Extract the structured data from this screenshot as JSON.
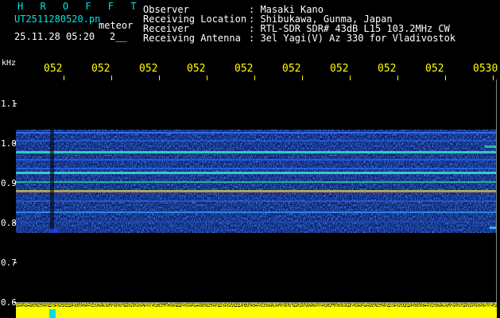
{
  "header": {
    "station": "H R O F F T",
    "filename": "UT2511280520.pn",
    "mode": "meteor",
    "datetime": "25.11.28 05:20",
    "code": "2__",
    "info": [
      {
        "label": "Observer",
        "value": ": Masaki Kano"
      },
      {
        "label": "Receiving Location",
        "value": ": Shibukawa, Gunma, Japan"
      },
      {
        "label": "Receiver",
        "value": ": RTL-SDR SDR# 43dB L15 103.2MHz CW"
      },
      {
        "label": "Receiving Antenna",
        "value": ": 3el Yagi(V) Az 330 for Vladivostok"
      }
    ]
  },
  "axis": {
    "unit": "kHz",
    "x_ticks": [
      "052",
      "052",
      "052",
      "052",
      "052",
      "052",
      "052",
      "052",
      "052",
      "0530"
    ],
    "y_ticks": [
      "1.1",
      "1.0",
      "0.9",
      "0.8",
      "0.7",
      "0.6"
    ]
  },
  "colors": {
    "header_cyan": "#00e5e5",
    "tick_yellow": "#ffff00",
    "strip_yellow": "#ffff00",
    "background": "#000000"
  }
}
